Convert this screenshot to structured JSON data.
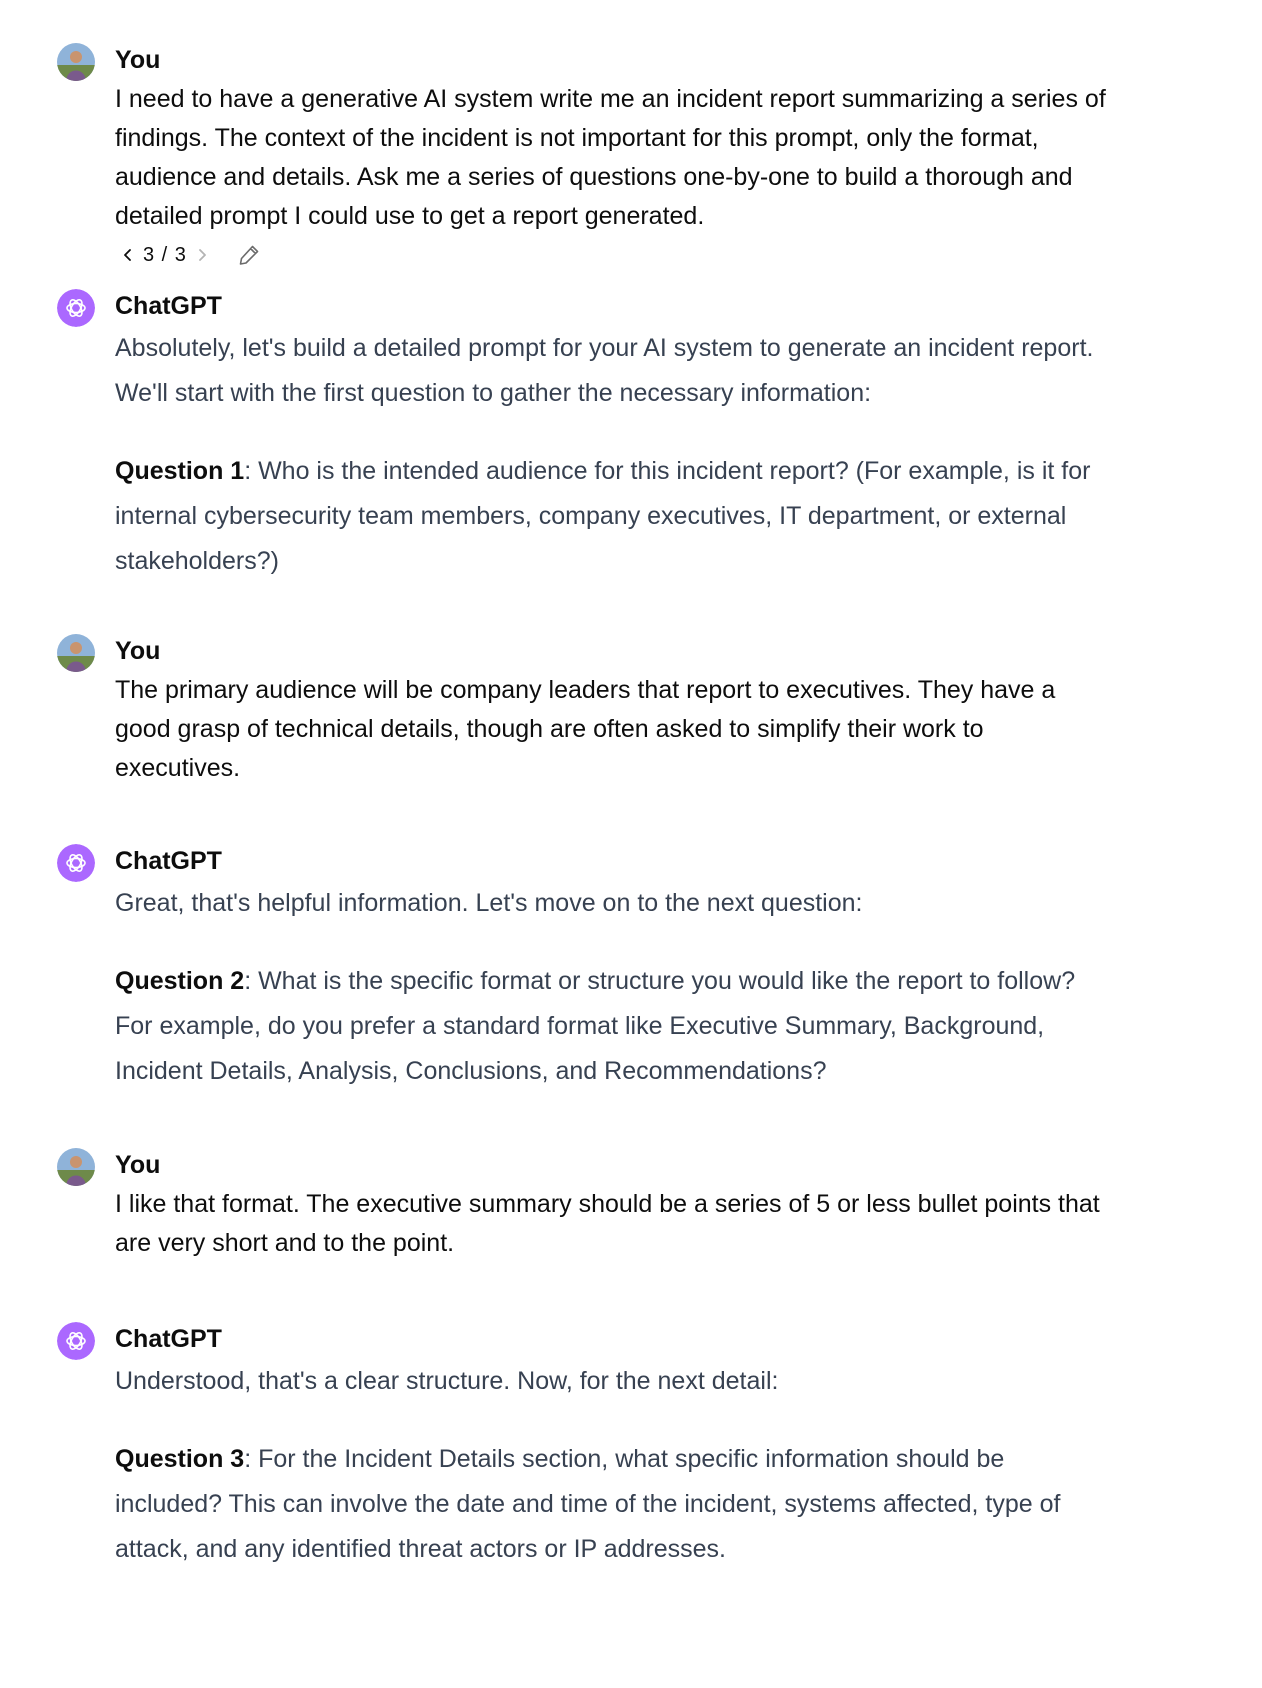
{
  "conversation": {
    "messages": [
      {
        "role": "user",
        "author": "You",
        "text": "I need to have a generative AI system write me an incident report summarizing a series of findings. The context of the incident is not important for this prompt, only the format, audience and details. Ask me a series of questions one-by-one to build a thorough and detailed prompt I could use to get a report generated.",
        "pager": {
          "label": "3 / 3",
          "prev_icon": "chevron-left-icon",
          "next_icon": "chevron-right-icon",
          "edit_icon": "pencil-icon"
        }
      },
      {
        "role": "assistant",
        "author": "ChatGPT",
        "intro": "Absolutely, let's build a detailed prompt for your AI system to generate an incident report. We'll start with the first question to gather the necessary information:",
        "question_label": "Question 1",
        "question_text": ": Who is the intended audience for this incident report? (For example, is it for internal cybersecurity team members, company executives, IT department, or external stakeholders?)"
      },
      {
        "role": "user",
        "author": "You",
        "text": "The primary audience will be company leaders that report to executives. They have a good grasp of technical details, though are often asked to simplify their work to executives."
      },
      {
        "role": "assistant",
        "author": "ChatGPT",
        "intro": "Great, that's helpful information. Let's move on to the next question:",
        "question_label": "Question 2",
        "question_text": ": What is the specific format or structure you would like the report to follow? For example, do you prefer a standard format like Executive Summary, Background, Incident Details, Analysis, Conclusions, and Recommendations?"
      },
      {
        "role": "user",
        "author": "You",
        "text": "I like that format. The executive summary should be a series of 5 or less bullet points that are very short and to the point."
      },
      {
        "role": "assistant",
        "author": "ChatGPT",
        "intro": "Understood, that's a clear structure. Now, for the next detail:",
        "question_label": "Question 3",
        "question_text": ": For the Incident Details section, what specific information should be included? This can involve the date and time of the incident, systems affected, type of attack, and any identified threat actors or IP addresses."
      }
    ]
  },
  "colors": {
    "assistant_avatar": "#ab68ff",
    "assistant_text": "#374151",
    "user_text": "#0d0d0d"
  },
  "icons": {
    "user_avatar": "user-avatar-photo",
    "assistant_avatar": "openai-logo-icon"
  }
}
